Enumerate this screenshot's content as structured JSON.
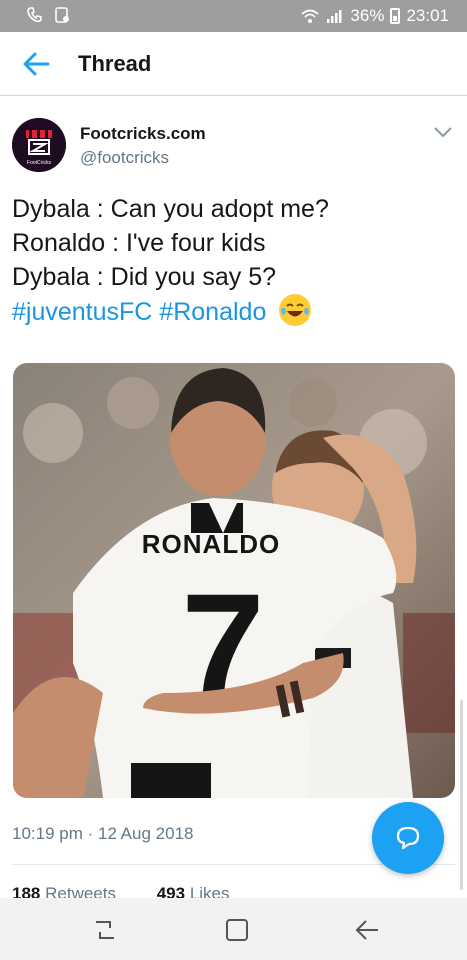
{
  "status_bar": {
    "battery_percent": "36%",
    "time": "23:01"
  },
  "header": {
    "title": "Thread"
  },
  "tweet": {
    "author_name": "Footcricks.com",
    "author_handle": "@footcricks",
    "avatar_caption": "FootCricks",
    "lines": [
      "Dybala : Can you adopt me?",
      "Ronaldo : I've four kids",
      "Dybala : Did you say 5?"
    ],
    "hashtags": [
      "#juventusFC",
      "#Ronaldo"
    ],
    "emoji": "face-with-tears-of-joy",
    "photo": {
      "jersey_name": "RONALDO",
      "jersey_number": "7"
    },
    "timestamp": "10:19 pm · 12 Aug 2018",
    "retweets_count": "188",
    "retweets_label": "Retweets",
    "likes_count": "493",
    "likes_label": "Likes"
  },
  "icons": {
    "back": "back-arrow-icon",
    "more": "chevron-down-icon",
    "compose": "reply-bubble-icon",
    "nav_recent": "recent-apps-icon",
    "nav_home": "home-square-icon",
    "nav_back": "back-nav-icon"
  },
  "colors": {
    "accent": "#1da1f2",
    "hashtag": "#1b95e0",
    "status_bar": "#9e9e9e"
  }
}
